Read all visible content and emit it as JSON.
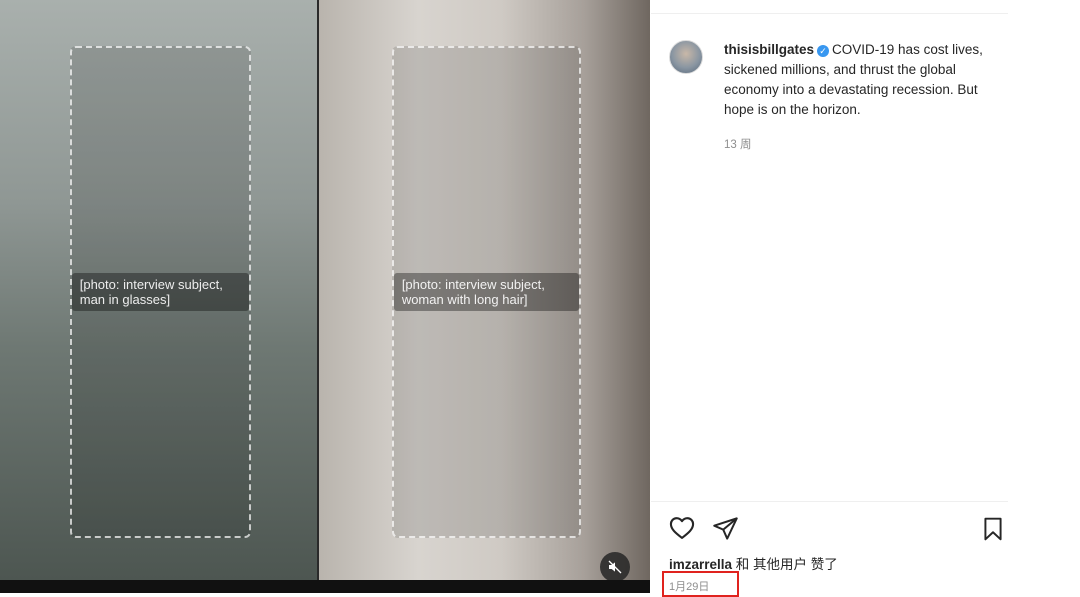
{
  "media": {
    "left_subject_placeholder": "[photo: interview subject, man in glasses]",
    "right_subject_placeholder": "[photo: interview subject, woman with long hair]"
  },
  "post": {
    "username": "thisisbillgates",
    "caption": "COVID-19 has cost lives, sickened millions, and thrust the global economy into a devastating recession. But hope is on the horizon.",
    "time_ago": "13 周"
  },
  "actions": {
    "like_icon": "heart-icon",
    "share_icon": "send-icon",
    "save_icon": "bookmark-icon"
  },
  "likes": {
    "user": "imzarrella",
    "rest": " 和 其他用户 赞了"
  },
  "date": "1月29日",
  "colors": {
    "verified": "#3897f0",
    "highlight_border": "#e0231e",
    "muted_text": "#8e8e8e"
  }
}
